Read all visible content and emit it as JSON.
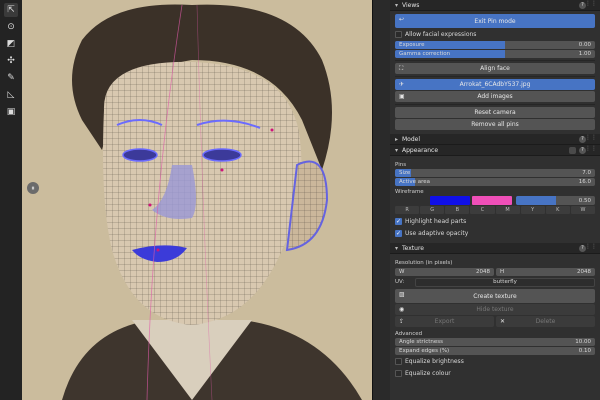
{
  "toolbar": {
    "tools": [
      {
        "name": "select-tool-icon",
        "glyph": "⇱"
      },
      {
        "name": "cursor-tool-icon",
        "glyph": "⊙"
      },
      {
        "name": "scale-tool-icon",
        "glyph": "◩"
      },
      {
        "name": "transform-tool-icon",
        "glyph": "✣"
      },
      {
        "name": "annotate-tool-icon",
        "glyph": "✎"
      },
      {
        "name": "measure-tool-icon",
        "glyph": "◺"
      },
      {
        "name": "add-object-tool-icon",
        "glyph": "▣"
      }
    ]
  },
  "viewport": {
    "pin_badge": "⏸"
  },
  "panel": {
    "views": {
      "title": "Views",
      "exit_pin_mode": "Exit Pin mode",
      "allow_facial_expressions": "Allow facial expressions",
      "exposure_label": "Exposure",
      "exposure_value": "0.00",
      "gamma_label": "Gamma correction",
      "gamma_value": "1.00",
      "align_face": "Align face",
      "image_file": "Arrokat_6CAdbY537.jpg",
      "add_images": "Add images",
      "reset_camera": "Reset camera",
      "remove_all_pins": "Remove all pins"
    },
    "model": {
      "title": "Model"
    },
    "appearance": {
      "title": "Appearance",
      "pins_label": "Pins",
      "size_label": "Size",
      "size_value": "7.0",
      "active_area_label": "Active area",
      "active_area_value": "16.0",
      "wireframe_label": "Wireframe",
      "wireframe_opacity": "0.50",
      "color_a": "#1010e8",
      "color_b": "#ef4fb8",
      "axes": [
        "R",
        "G",
        "B",
        "C",
        "M",
        "Y",
        "K",
        "W"
      ],
      "highlight_head_parts": "Highlight head parts",
      "use_adaptive_opacity": "Use adaptive opacity"
    },
    "texture": {
      "title": "Texture",
      "resolution_label": "Resolution (in pixels)",
      "w_label": "W",
      "w_value": "2048",
      "h_label": "H",
      "h_value": "2048",
      "uv_label": "UV:",
      "uv_value": "butterfly",
      "create_texture": "Create texture",
      "hide_texture": "Hide texture",
      "export": "Export",
      "delete": "Delete",
      "advanced_label": "Advanced",
      "angle_strictness_label": "Angle strictness",
      "angle_strictness_value": "10.00",
      "expand_edges_label": "Expand edges (%)",
      "expand_edges_value": "0.10",
      "equalize_brightness": "Equalize brightness",
      "equalize_colour": "Equalize colour"
    }
  }
}
